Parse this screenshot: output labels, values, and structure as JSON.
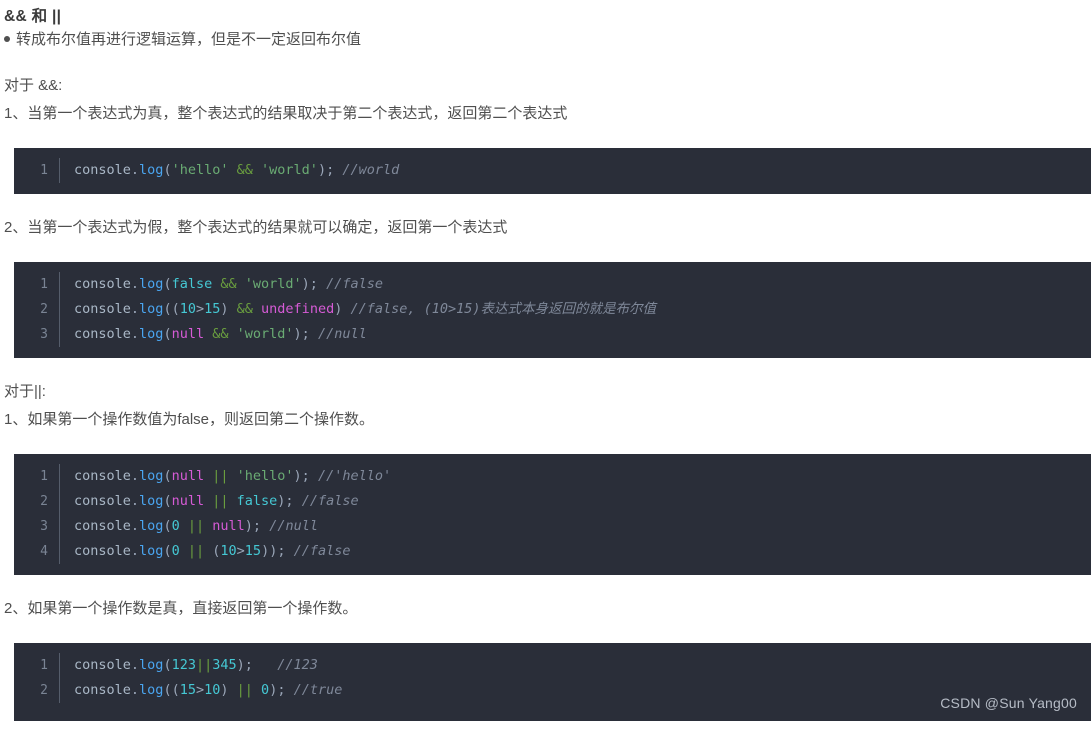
{
  "document": {
    "title": "&& 和 ||",
    "blocks": [
      {
        "kind": "bullet",
        "text": "转成布尔值再进行逻辑运算，但是不一定返回布尔值"
      },
      {
        "kind": "para",
        "text": "对于 &&:"
      },
      {
        "kind": "para",
        "text": "1、当第一个表达式为真，整个表达式的结果取决于第二个表达式，返回第二个表达式"
      },
      {
        "kind": "code",
        "lines": [
          {
            "no": "1",
            "tokens": [
              {
                "t": "console",
                "c": "t-obj"
              },
              {
                "t": ".",
                "c": "t-punc"
              },
              {
                "t": "log",
                "c": "t-fn"
              },
              {
                "t": "(",
                "c": "t-punc"
              },
              {
                "t": "'hello'",
                "c": "t-str"
              },
              {
                "t": " ",
                "c": "t-punc"
              },
              {
                "t": "&&",
                "c": "t-op"
              },
              {
                "t": " ",
                "c": "t-punc"
              },
              {
                "t": "'world'",
                "c": "t-str"
              },
              {
                "t": ");",
                "c": "t-punc"
              },
              {
                "t": " ",
                "c": "t-punc"
              },
              {
                "t": "//world",
                "c": "t-cmt"
              }
            ]
          }
        ]
      },
      {
        "kind": "para",
        "text": "2、当第一个表达式为假，整个表达式的结果就可以确定，返回第一个表达式"
      },
      {
        "kind": "code",
        "lines": [
          {
            "no": "1",
            "tokens": [
              {
                "t": "console",
                "c": "t-obj"
              },
              {
                "t": ".",
                "c": "t-punc"
              },
              {
                "t": "log",
                "c": "t-fn"
              },
              {
                "t": "(",
                "c": "t-punc"
              },
              {
                "t": "false",
                "c": "t-bool"
              },
              {
                "t": " ",
                "c": "t-punc"
              },
              {
                "t": "&&",
                "c": "t-op"
              },
              {
                "t": " ",
                "c": "t-punc"
              },
              {
                "t": "'world'",
                "c": "t-str"
              },
              {
                "t": ");",
                "c": "t-punc"
              },
              {
                "t": " ",
                "c": "t-punc"
              },
              {
                "t": "//false",
                "c": "t-cmt"
              }
            ]
          },
          {
            "no": "2",
            "tokens": [
              {
                "t": "console",
                "c": "t-obj"
              },
              {
                "t": ".",
                "c": "t-punc"
              },
              {
                "t": "log",
                "c": "t-fn"
              },
              {
                "t": "((",
                "c": "t-punc"
              },
              {
                "t": "10",
                "c": "t-num"
              },
              {
                "t": ">",
                "c": "t-punc"
              },
              {
                "t": "15",
                "c": "t-num"
              },
              {
                "t": ") ",
                "c": "t-punc"
              },
              {
                "t": "&&",
                "c": "t-op"
              },
              {
                "t": " ",
                "c": "t-punc"
              },
              {
                "t": "undefined",
                "c": "t-null"
              },
              {
                "t": ")",
                "c": "t-punc"
              },
              {
                "t": " ",
                "c": "t-punc"
              },
              {
                "t": "//false, (10>15)",
                "c": "t-cmt"
              },
              {
                "t": "表达式本身返回的就是布尔值",
                "c": "t-cmtcn"
              }
            ]
          },
          {
            "no": "3",
            "tokens": [
              {
                "t": "console",
                "c": "t-obj"
              },
              {
                "t": ".",
                "c": "t-punc"
              },
              {
                "t": "log",
                "c": "t-fn"
              },
              {
                "t": "(",
                "c": "t-punc"
              },
              {
                "t": "null",
                "c": "t-null"
              },
              {
                "t": " ",
                "c": "t-punc"
              },
              {
                "t": "&&",
                "c": "t-op"
              },
              {
                "t": " ",
                "c": "t-punc"
              },
              {
                "t": "'world'",
                "c": "t-str"
              },
              {
                "t": ");",
                "c": "t-punc"
              },
              {
                "t": " ",
                "c": "t-punc"
              },
              {
                "t": "//null",
                "c": "t-cmt"
              }
            ]
          }
        ]
      },
      {
        "kind": "para",
        "text": "对于||:"
      },
      {
        "kind": "para",
        "text": "1、如果第一个操作数值为false，则返回第二个操作数。"
      },
      {
        "kind": "code",
        "lines": [
          {
            "no": "1",
            "tokens": [
              {
                "t": "console",
                "c": "t-obj"
              },
              {
                "t": ".",
                "c": "t-punc"
              },
              {
                "t": "log",
                "c": "t-fn"
              },
              {
                "t": "(",
                "c": "t-punc"
              },
              {
                "t": "null",
                "c": "t-null"
              },
              {
                "t": " ",
                "c": "t-punc"
              },
              {
                "t": "||",
                "c": "t-op"
              },
              {
                "t": " ",
                "c": "t-punc"
              },
              {
                "t": "'hello'",
                "c": "t-str"
              },
              {
                "t": ");",
                "c": "t-punc"
              },
              {
                "t": " ",
                "c": "t-punc"
              },
              {
                "t": "//'hello'",
                "c": "t-cmt"
              }
            ]
          },
          {
            "no": "2",
            "tokens": [
              {
                "t": "console",
                "c": "t-obj"
              },
              {
                "t": ".",
                "c": "t-punc"
              },
              {
                "t": "log",
                "c": "t-fn"
              },
              {
                "t": "(",
                "c": "t-punc"
              },
              {
                "t": "null",
                "c": "t-null"
              },
              {
                "t": " ",
                "c": "t-punc"
              },
              {
                "t": "||",
                "c": "t-op"
              },
              {
                "t": " ",
                "c": "t-punc"
              },
              {
                "t": "false",
                "c": "t-bool"
              },
              {
                "t": ");",
                "c": "t-punc"
              },
              {
                "t": " ",
                "c": "t-punc"
              },
              {
                "t": "//false",
                "c": "t-cmt"
              }
            ]
          },
          {
            "no": "3",
            "tokens": [
              {
                "t": "console",
                "c": "t-obj"
              },
              {
                "t": ".",
                "c": "t-punc"
              },
              {
                "t": "log",
                "c": "t-fn"
              },
              {
                "t": "(",
                "c": "t-punc"
              },
              {
                "t": "0",
                "c": "t-num"
              },
              {
                "t": " ",
                "c": "t-punc"
              },
              {
                "t": "||",
                "c": "t-op"
              },
              {
                "t": " ",
                "c": "t-punc"
              },
              {
                "t": "null",
                "c": "t-null"
              },
              {
                "t": ");",
                "c": "t-punc"
              },
              {
                "t": " ",
                "c": "t-punc"
              },
              {
                "t": "//null",
                "c": "t-cmt"
              }
            ]
          },
          {
            "no": "4",
            "tokens": [
              {
                "t": "console",
                "c": "t-obj"
              },
              {
                "t": ".",
                "c": "t-punc"
              },
              {
                "t": "log",
                "c": "t-fn"
              },
              {
                "t": "(",
                "c": "t-punc"
              },
              {
                "t": "0",
                "c": "t-num"
              },
              {
                "t": " ",
                "c": "t-punc"
              },
              {
                "t": "||",
                "c": "t-op"
              },
              {
                "t": " (",
                "c": "t-punc"
              },
              {
                "t": "10",
                "c": "t-num"
              },
              {
                "t": ">",
                "c": "t-punc"
              },
              {
                "t": "15",
                "c": "t-num"
              },
              {
                "t": "));",
                "c": "t-punc"
              },
              {
                "t": " ",
                "c": "t-punc"
              },
              {
                "t": "//false",
                "c": "t-cmt"
              }
            ]
          }
        ]
      },
      {
        "kind": "para",
        "text": "2、如果第一个操作数是真，直接返回第一个操作数。"
      },
      {
        "kind": "code",
        "last": true,
        "lines": [
          {
            "no": "1",
            "tokens": [
              {
                "t": "console",
                "c": "t-obj"
              },
              {
                "t": ".",
                "c": "t-punc"
              },
              {
                "t": "log",
                "c": "t-fn"
              },
              {
                "t": "(",
                "c": "t-punc"
              },
              {
                "t": "123",
                "c": "t-num"
              },
              {
                "t": "||",
                "c": "t-op"
              },
              {
                "t": "345",
                "c": "t-num"
              },
              {
                "t": ");",
                "c": "t-punc"
              },
              {
                "t": "   ",
                "c": "t-punc"
              },
              {
                "t": "//123",
                "c": "t-cmt"
              }
            ]
          },
          {
            "no": "2",
            "tokens": [
              {
                "t": "console",
                "c": "t-obj"
              },
              {
                "t": ".",
                "c": "t-punc"
              },
              {
                "t": "log",
                "c": "t-fn"
              },
              {
                "t": "((",
                "c": "t-punc"
              },
              {
                "t": "15",
                "c": "t-num"
              },
              {
                "t": ">",
                "c": "t-punc"
              },
              {
                "t": "10",
                "c": "t-num"
              },
              {
                "t": ") ",
                "c": "t-punc"
              },
              {
                "t": "||",
                "c": "t-op"
              },
              {
                "t": " ",
                "c": "t-punc"
              },
              {
                "t": "0",
                "c": "t-num"
              },
              {
                "t": ");",
                "c": "t-punc"
              },
              {
                "t": " ",
                "c": "t-punc"
              },
              {
                "t": "//true",
                "c": "t-cmt"
              }
            ]
          }
        ]
      }
    ]
  },
  "watermark": {
    "text": "CSDN @Sun Yang00"
  },
  "colors": {
    "code_background": "#2a2e39",
    "page_background": "#ffffff",
    "body_text": "#4f4f4f",
    "string": "#6aab73",
    "operator": "#6a9e3f",
    "function": "#4aa5f0",
    "boolean": "#45c8d4",
    "null_literal": "#d65bd6",
    "comment": "#7f8899",
    "line_number": "#7a8494"
  }
}
